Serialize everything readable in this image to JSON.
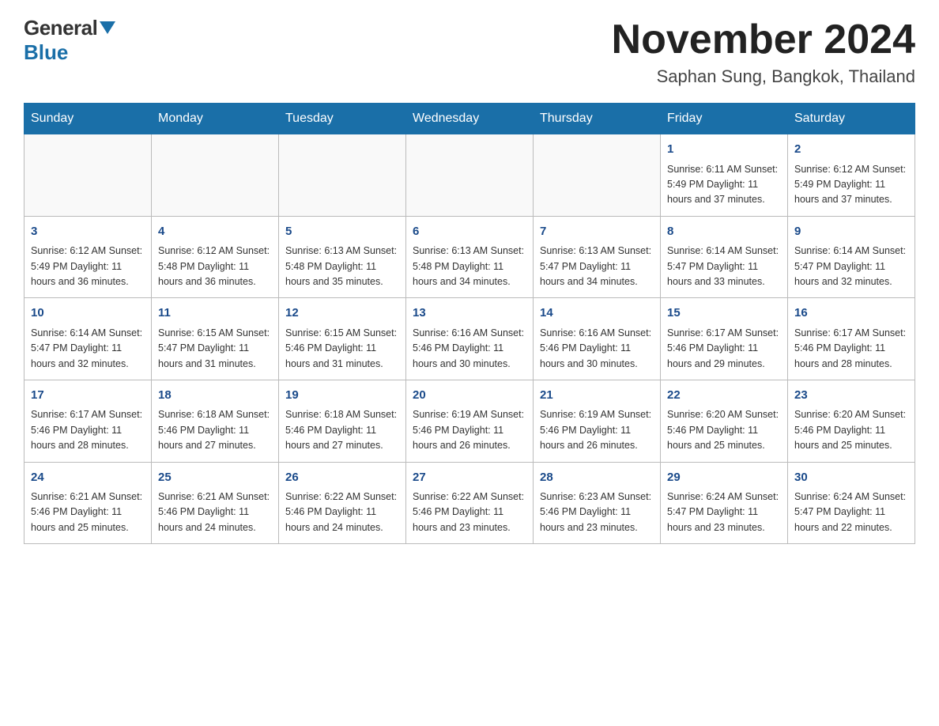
{
  "logo": {
    "general": "General",
    "blue": "Blue"
  },
  "header": {
    "month_year": "November 2024",
    "location": "Saphan Sung, Bangkok, Thailand"
  },
  "days_of_week": [
    "Sunday",
    "Monday",
    "Tuesday",
    "Wednesday",
    "Thursday",
    "Friday",
    "Saturday"
  ],
  "weeks": [
    [
      {
        "day": "",
        "info": ""
      },
      {
        "day": "",
        "info": ""
      },
      {
        "day": "",
        "info": ""
      },
      {
        "day": "",
        "info": ""
      },
      {
        "day": "",
        "info": ""
      },
      {
        "day": "1",
        "info": "Sunrise: 6:11 AM\nSunset: 5:49 PM\nDaylight: 11 hours and 37 minutes."
      },
      {
        "day": "2",
        "info": "Sunrise: 6:12 AM\nSunset: 5:49 PM\nDaylight: 11 hours and 37 minutes."
      }
    ],
    [
      {
        "day": "3",
        "info": "Sunrise: 6:12 AM\nSunset: 5:49 PM\nDaylight: 11 hours and 36 minutes."
      },
      {
        "day": "4",
        "info": "Sunrise: 6:12 AM\nSunset: 5:48 PM\nDaylight: 11 hours and 36 minutes."
      },
      {
        "day": "5",
        "info": "Sunrise: 6:13 AM\nSunset: 5:48 PM\nDaylight: 11 hours and 35 minutes."
      },
      {
        "day": "6",
        "info": "Sunrise: 6:13 AM\nSunset: 5:48 PM\nDaylight: 11 hours and 34 minutes."
      },
      {
        "day": "7",
        "info": "Sunrise: 6:13 AM\nSunset: 5:47 PM\nDaylight: 11 hours and 34 minutes."
      },
      {
        "day": "8",
        "info": "Sunrise: 6:14 AM\nSunset: 5:47 PM\nDaylight: 11 hours and 33 minutes."
      },
      {
        "day": "9",
        "info": "Sunrise: 6:14 AM\nSunset: 5:47 PM\nDaylight: 11 hours and 32 minutes."
      }
    ],
    [
      {
        "day": "10",
        "info": "Sunrise: 6:14 AM\nSunset: 5:47 PM\nDaylight: 11 hours and 32 minutes."
      },
      {
        "day": "11",
        "info": "Sunrise: 6:15 AM\nSunset: 5:47 PM\nDaylight: 11 hours and 31 minutes."
      },
      {
        "day": "12",
        "info": "Sunrise: 6:15 AM\nSunset: 5:46 PM\nDaylight: 11 hours and 31 minutes."
      },
      {
        "day": "13",
        "info": "Sunrise: 6:16 AM\nSunset: 5:46 PM\nDaylight: 11 hours and 30 minutes."
      },
      {
        "day": "14",
        "info": "Sunrise: 6:16 AM\nSunset: 5:46 PM\nDaylight: 11 hours and 30 minutes."
      },
      {
        "day": "15",
        "info": "Sunrise: 6:17 AM\nSunset: 5:46 PM\nDaylight: 11 hours and 29 minutes."
      },
      {
        "day": "16",
        "info": "Sunrise: 6:17 AM\nSunset: 5:46 PM\nDaylight: 11 hours and 28 minutes."
      }
    ],
    [
      {
        "day": "17",
        "info": "Sunrise: 6:17 AM\nSunset: 5:46 PM\nDaylight: 11 hours and 28 minutes."
      },
      {
        "day": "18",
        "info": "Sunrise: 6:18 AM\nSunset: 5:46 PM\nDaylight: 11 hours and 27 minutes."
      },
      {
        "day": "19",
        "info": "Sunrise: 6:18 AM\nSunset: 5:46 PM\nDaylight: 11 hours and 27 minutes."
      },
      {
        "day": "20",
        "info": "Sunrise: 6:19 AM\nSunset: 5:46 PM\nDaylight: 11 hours and 26 minutes."
      },
      {
        "day": "21",
        "info": "Sunrise: 6:19 AM\nSunset: 5:46 PM\nDaylight: 11 hours and 26 minutes."
      },
      {
        "day": "22",
        "info": "Sunrise: 6:20 AM\nSunset: 5:46 PM\nDaylight: 11 hours and 25 minutes."
      },
      {
        "day": "23",
        "info": "Sunrise: 6:20 AM\nSunset: 5:46 PM\nDaylight: 11 hours and 25 minutes."
      }
    ],
    [
      {
        "day": "24",
        "info": "Sunrise: 6:21 AM\nSunset: 5:46 PM\nDaylight: 11 hours and 25 minutes."
      },
      {
        "day": "25",
        "info": "Sunrise: 6:21 AM\nSunset: 5:46 PM\nDaylight: 11 hours and 24 minutes."
      },
      {
        "day": "26",
        "info": "Sunrise: 6:22 AM\nSunset: 5:46 PM\nDaylight: 11 hours and 24 minutes."
      },
      {
        "day": "27",
        "info": "Sunrise: 6:22 AM\nSunset: 5:46 PM\nDaylight: 11 hours and 23 minutes."
      },
      {
        "day": "28",
        "info": "Sunrise: 6:23 AM\nSunset: 5:46 PM\nDaylight: 11 hours and 23 minutes."
      },
      {
        "day": "29",
        "info": "Sunrise: 6:24 AM\nSunset: 5:47 PM\nDaylight: 11 hours and 23 minutes."
      },
      {
        "day": "30",
        "info": "Sunrise: 6:24 AM\nSunset: 5:47 PM\nDaylight: 11 hours and 22 minutes."
      }
    ]
  ]
}
